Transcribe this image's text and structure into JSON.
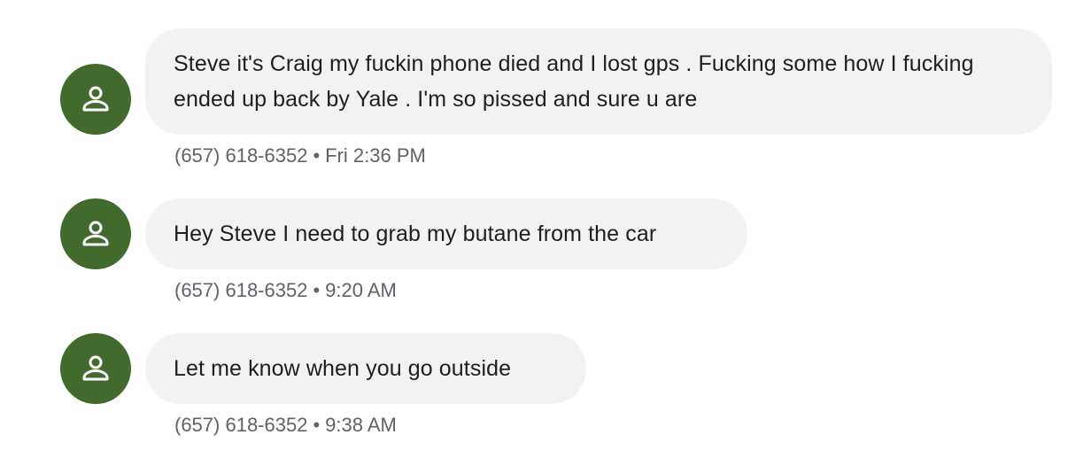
{
  "messages": [
    {
      "text": "Steve it's Craig my fuckin phone died and I lost gps . Fucking some how I fucking ended up back by Yale . I'm so pissed and sure u are",
      "sender": "(657) 618-6352",
      "time": "Fri 2:36 PM"
    },
    {
      "text": "Hey Steve I need to grab my butane from the car",
      "sender": "(657) 618-6352",
      "time": "9:20 AM"
    },
    {
      "text": "Let me know when you go outside",
      "sender": "(657) 618-6352",
      "time": "9:38 AM"
    }
  ],
  "separator": "•",
  "avatar": {
    "icon": "person-icon",
    "color": "#426a2c"
  },
  "bubble_color": "#f1f2f4"
}
